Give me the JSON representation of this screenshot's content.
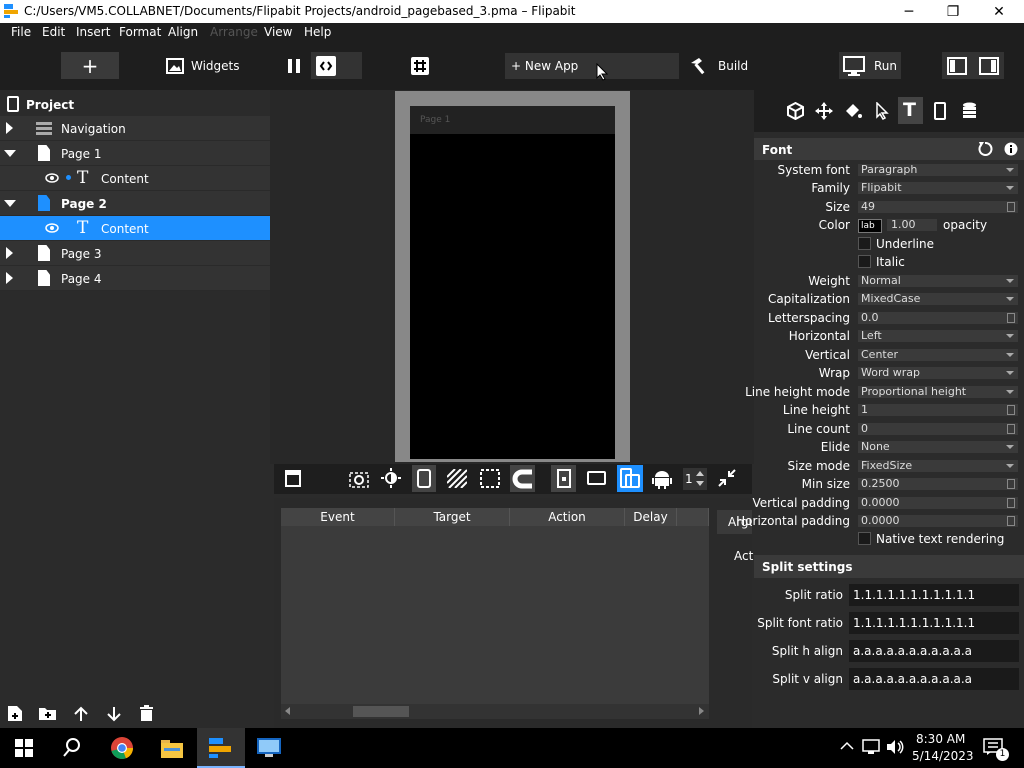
{
  "window": {
    "title": "C:/Users/VM5.COLLABNET/Documents/Flipabit Projects/android_pagebased_3.pma – Flipabit",
    "minimize": "─",
    "maximize": "❐",
    "close": "✕"
  },
  "menu": [
    "File",
    "Edit",
    "Insert",
    "Format",
    "Align",
    "Arrange",
    "View",
    "Help"
  ],
  "toolbar": {
    "add": "+",
    "widgets": "Widgets",
    "new_app": "+ New App",
    "build": "Build",
    "run": "Run"
  },
  "project": {
    "title": "Project",
    "items": [
      {
        "label": "Navigation"
      },
      {
        "label": "Page 1"
      },
      {
        "label": "Content"
      },
      {
        "label": "Page 2"
      },
      {
        "label": "Content"
      },
      {
        "label": "Page 3"
      },
      {
        "label": "Page 4"
      }
    ]
  },
  "canvas": {
    "page_header": "Page 1",
    "counter": "1"
  },
  "events": {
    "columns": [
      "Event",
      "Target",
      "Action",
      "Delay"
    ],
    "tab_args": "Argu",
    "tab_act": "Act"
  },
  "font": {
    "title": "Font",
    "system_font_label": "System font",
    "system_font": "Paragraph",
    "family_label": "Family",
    "family": "Flipabit",
    "size_label": "Size",
    "size": "49",
    "color_label": "Color",
    "color_swatch": "lab",
    "opacity_value": "1.00",
    "opacity_label": "opacity",
    "underline": "Underline",
    "italic": "Italic",
    "weight_label": "Weight",
    "weight": "Normal",
    "cap_label": "Capitalization",
    "cap": "MixedCase",
    "letter_label": "Letterspacing",
    "letter": "0.0",
    "horiz_label": "Horizontal",
    "horiz": "Left",
    "vert_label": "Vertical",
    "vert": "Center",
    "wrap_label": "Wrap",
    "wrap": "Word wrap",
    "lhmode_label": "Line height mode",
    "lhmode": "Proportional height",
    "lh_label": "Line height",
    "lh": "1",
    "lcount_label": "Line count",
    "lcount": "0",
    "elide_label": "Elide",
    "elide": "None",
    "sizemode_label": "Size mode",
    "sizemode": "FixedSize",
    "minsize_label": "Min size",
    "minsize": "0.2500",
    "vpad_label": "Vertical padding",
    "vpad": "0.0000",
    "hpad_label": "Horizontal padding",
    "hpad": "0.0000",
    "native": "Native text rendering"
  },
  "split": {
    "title": "Split settings",
    "ratio_label": "Split ratio",
    "ratio": "1.1.1.1.1.1.1.1.1.1.1",
    "font_ratio_label": "Split font ratio",
    "font_ratio": "1.1.1.1.1.1.1.1.1.1.1",
    "halign_label": "Split h align",
    "halign": "a.a.a.a.a.a.a.a.a.a.a",
    "valign_label": "Split v align",
    "valign": "a.a.a.a.a.a.a.a.a.a.a"
  },
  "taskbar": {
    "time": "8:30 AM",
    "date": "5/14/2023",
    "notif_count": "1"
  },
  "colors": {
    "accent": "#1e90ff",
    "panel": "#2b2b2b",
    "toolbar": "#1e1e1e"
  }
}
